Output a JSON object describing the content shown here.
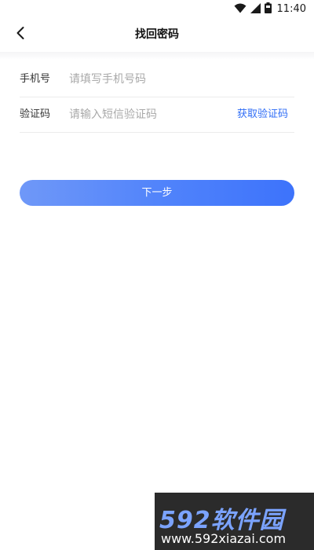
{
  "status_bar": {
    "time": "11:40",
    "icons": [
      "wifi-icon",
      "signal-icon",
      "battery-icon"
    ]
  },
  "nav": {
    "back_icon": "chevron-left-icon",
    "title": "找回密码"
  },
  "form": {
    "phone": {
      "label": "手机号",
      "placeholder": "请填写手机号码",
      "value": ""
    },
    "code": {
      "label": "验证码",
      "placeholder": "请输入短信验证码",
      "value": "",
      "get_code_label": "获取验证码"
    }
  },
  "next_button": {
    "label": "下一步"
  },
  "watermark": {
    "brand": "592软件园",
    "url": "www.592xiazai.com"
  },
  "colors": {
    "accent": "#2f6df6",
    "button_gradient_start": "#6f98f8",
    "button_gradient_end": "#3d73fb",
    "watermark_bg": "#2b2b2b",
    "watermark_brand": "#7ba3ff"
  }
}
